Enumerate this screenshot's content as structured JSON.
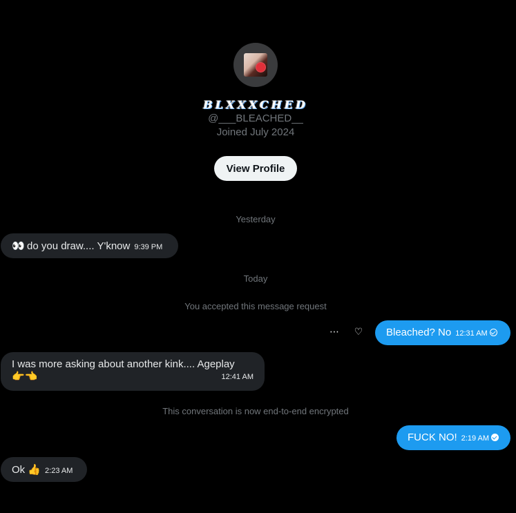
{
  "profile": {
    "display_name": "BLXXXCHED",
    "handle": "@___BLEACHED__",
    "joined": "Joined July 2024",
    "view_profile_label": "View Profile"
  },
  "separators": {
    "yesterday": "Yesterday",
    "today": "Today",
    "accepted": "You accepted this message request",
    "encrypted": "This conversation is now end-to-end encrypted"
  },
  "messages": [
    {
      "direction": "incoming",
      "emoji": "👀",
      "text": "do you draw.... Y'know",
      "time": "9:39 PM"
    },
    {
      "direction": "outgoing",
      "text": "Bleached? No",
      "time": "12:31 AM",
      "status": "sent"
    },
    {
      "direction": "incoming",
      "text": "I was more asking about another kink.... Ageplay",
      "emoji_line": "👉👈",
      "time": "12:41 AM"
    },
    {
      "direction": "outgoing",
      "text": "FUCK NO!",
      "time": "2:19 AM",
      "status": "read"
    },
    {
      "direction": "incoming",
      "text": "Ok",
      "emoji": "👍",
      "time": "2:23 AM"
    }
  ],
  "icons": {
    "more": "more-icon",
    "react": "heart-add-icon"
  },
  "colors": {
    "background": "#000000",
    "incoming_bubble": "#202327",
    "outgoing_bubble": "#1d9bf0",
    "muted_text": "#71767b"
  }
}
